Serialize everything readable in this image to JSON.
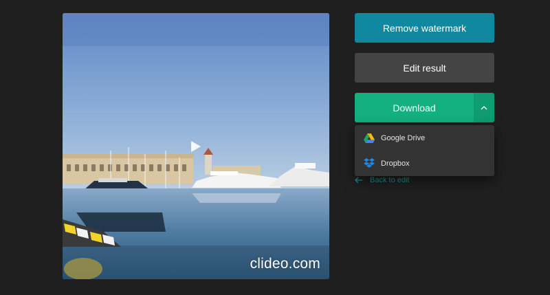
{
  "preview": {
    "watermark": "clideo.com",
    "play_icon": "play-icon"
  },
  "actions": {
    "remove_watermark_label": "Remove watermark",
    "edit_result_label": "Edit result",
    "download_label": "Download",
    "toggle_icon": "chevron-up-icon",
    "back_label": "Back to edit"
  },
  "download_menu": {
    "items": [
      {
        "label": "Google Drive",
        "icon": "google-drive-icon"
      },
      {
        "label": "Dropbox",
        "icon": "dropbox-icon"
      }
    ]
  },
  "colors": {
    "background": "#1f1f1f",
    "remove_button": "#10889f",
    "edit_button": "#444444",
    "download_button": "#14b07f",
    "download_toggle": "#0f9c70",
    "link": "#1a8f8a",
    "menu": "#333333"
  }
}
